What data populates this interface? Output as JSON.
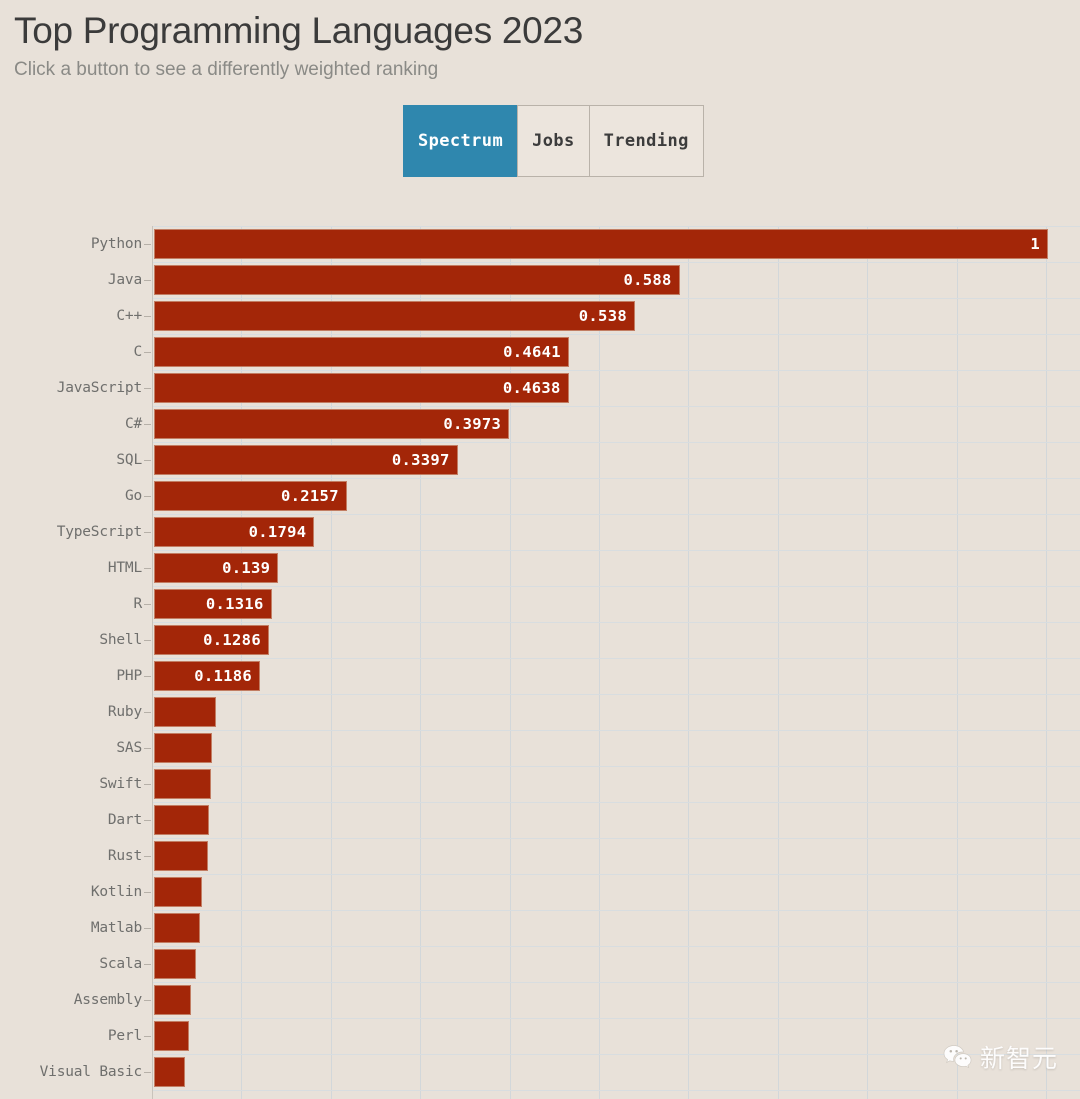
{
  "header": {
    "title": "Top Programming Languages 2023",
    "subtitle": "Click a button to see a differently weighted ranking"
  },
  "buttons": [
    {
      "label": "Spectrum",
      "active": true
    },
    {
      "label": "Jobs",
      "active": false
    },
    {
      "label": "Trending",
      "active": false
    }
  ],
  "watermark": {
    "text": "新智元",
    "icon": "wechat-icon"
  },
  "colors": {
    "background": "#e8e1d9",
    "bar": "#a32608",
    "bar_border": "#c27d63",
    "accent_active": "#2f87ae",
    "grid": "#d2d7da",
    "label_text": "#6f6f6d",
    "title_text": "#3b3b3b",
    "subtitle_text": "#8a8a86"
  },
  "chart_data": {
    "type": "bar",
    "orientation": "horizontal",
    "title": "Top Programming Languages 2023",
    "subtitle": "Click a button to see a differently weighted ranking",
    "ranking_mode": "Spectrum",
    "xlabel": "",
    "ylabel": "",
    "xlim": [
      0,
      1
    ],
    "grid": true,
    "legend": "none",
    "gridline_step": 0.1,
    "categories": [
      "Python",
      "Java",
      "C++",
      "C",
      "JavaScript",
      "C#",
      "SQL",
      "Go",
      "TypeScript",
      "HTML",
      "R",
      "Shell",
      "PHP",
      "Ruby",
      "SAS",
      "Swift",
      "Dart",
      "Rust",
      "Kotlin",
      "Matlab",
      "Scala",
      "Assembly",
      "Perl",
      "Visual Basic"
    ],
    "values": [
      1,
      0.588,
      0.538,
      0.4641,
      0.4638,
      0.3973,
      0.3397,
      0.2157,
      0.1794,
      0.139,
      0.1316,
      0.1286,
      0.1186,
      0.069,
      0.065,
      0.064,
      0.062,
      0.06,
      0.054,
      0.051,
      0.047,
      0.041,
      0.039,
      0.035
    ],
    "labels": [
      "1",
      "0.588",
      "0.538",
      "0.4641",
      "0.4638",
      "0.3973",
      "0.3397",
      "0.2157",
      "0.1794",
      "0.139",
      "0.1316",
      "0.1286",
      "0.1186",
      "",
      "",
      "",
      "",
      "",
      "",
      "",
      "",
      "",
      "",
      ""
    ]
  }
}
